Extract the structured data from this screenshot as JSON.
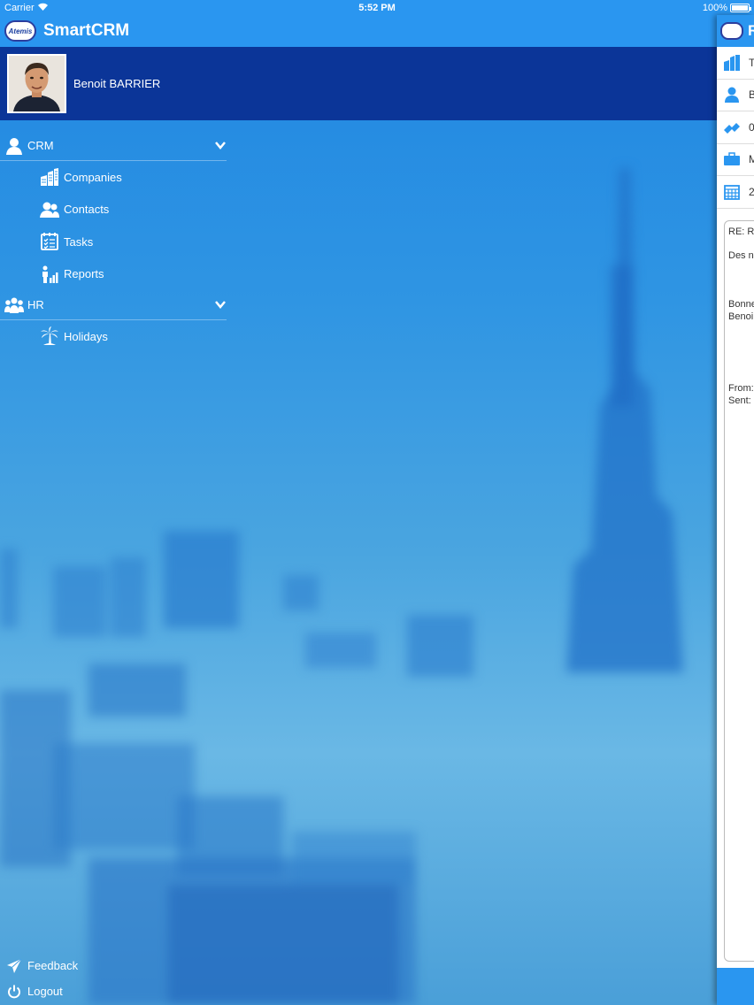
{
  "status_bar": {
    "carrier": "Carrier",
    "time": "5:52 PM",
    "battery": "100%"
  },
  "app": {
    "logo_text": "Atemis",
    "title": "SmartCRM"
  },
  "profile": {
    "name": "Benoit BARRIER"
  },
  "menu": {
    "sections": [
      {
        "label": "CRM",
        "icon": "person-icon",
        "items": [
          {
            "label": "Companies",
            "icon": "buildings-icon"
          },
          {
            "label": "Contacts",
            "icon": "contacts-icon"
          },
          {
            "label": "Tasks",
            "icon": "tasks-icon"
          },
          {
            "label": "Reports",
            "icon": "reports-icon"
          }
        ]
      },
      {
        "label": "HR",
        "icon": "group-icon",
        "items": [
          {
            "label": "Holidays",
            "icon": "palm-tree-icon"
          }
        ]
      }
    ]
  },
  "footer": {
    "feedback": "Feedback",
    "logout": "Logout"
  },
  "detail_panel": {
    "title_initial": "R",
    "rows": [
      "T",
      "B",
      "0",
      "M",
      "2"
    ],
    "mail_lines": {
      "subject": "RE: RI",
      "greeting": "Des n",
      "sign1": "Bonne",
      "sign2": "Benoi",
      "from": "From:",
      "sent": "Sent:"
    }
  },
  "colors": {
    "primary": "#2a96f0",
    "profile_bg": "#0b3598",
    "accent_icon": "#2a96f0"
  }
}
